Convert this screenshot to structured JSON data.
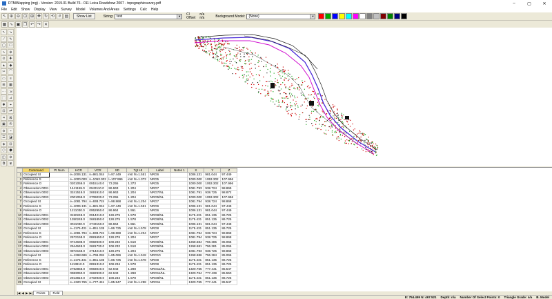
{
  "window": {
    "title": "DTM/Mapping (mg) - Version: 2019.01 Build 76 - 011 Leica Roadshow 2007 - topographicsurvey.pdf",
    "minimize": "–",
    "maximize": "▢",
    "close": "✕"
  },
  "menu": [
    "File",
    "Edit",
    "Show",
    "Display",
    "View",
    "Survey",
    "Model",
    "Volumes And Areas",
    "Settings",
    "Calc",
    "Help"
  ],
  "toolbar": {
    "show_list": "Show List",
    "string_label": "String:",
    "string_value": "test",
    "offset_top": "Cl",
    "offset_bottom": "Offset",
    "ratio_top": "n/a",
    "ratio_bottom": "n/a",
    "background_label": "Background Model:",
    "background_value": "(None)",
    "swatches": [
      "#ff0000",
      "#00aa00",
      "#0000ff",
      "#ffff00",
      "#00ffff",
      "#ff00ff",
      "#ffffff",
      "#808080",
      "#c0c0c0",
      "#800000",
      "#008000",
      "#000080",
      "#000000"
    ]
  },
  "grid": {
    "headers": [
      "Command",
      "Pt Num",
      "HCR",
      "VCR",
      "SD",
      "Tgt Ht",
      "Label",
      "Notes 1",
      "X",
      "Y",
      "Z"
    ],
    "rows": [
      [
        "Occupied St",
        "",
        "e=1006.131",
        "n=981.044",
        "l=97.449",
        "inst ht=1.551",
        "NRG6",
        "",
        "1006.131",
        "981.044",
        "97.449"
      ],
      [
        "Reference S",
        "",
        "e=1000.000",
        "n=1053.302",
        "l=107.996",
        "inst ht=1.373",
        "NRG5",
        "",
        "1000.000",
        "1053.302",
        "107.996"
      ],
      [
        "Reference O",
        "",
        "0201059.0",
        "0915140.0",
        "73.255",
        "1.373",
        "NRG5",
        "",
        "1000.000",
        "1053.302",
        "107.996"
      ],
      [
        "Observation 0001",
        "",
        "1441159.0",
        "0943110.0",
        "86.963",
        "1.204",
        "NRG7",
        "",
        "1081.793",
        "938.724",
        "98.869"
      ],
      [
        "Observation 0002",
        "",
        "3241519.0",
        "2691910.0",
        "86.963",
        "1.204",
        "NRG7/NL",
        "",
        "1081.791",
        "938.725",
        "98.872"
      ],
      [
        "Observation 0003",
        "",
        "2001059.0",
        "2709030.0",
        "73.255",
        "1.204",
        "NRG5/NL",
        "",
        "1000.000",
        "1053.302",
        "107.996"
      ],
      [
        "Occupied St",
        "",
        "e=1081.794",
        "n=938.724",
        "l=98.868",
        "inst ht=1.204",
        "NRG7",
        "",
        "1081.794",
        "938.724",
        "98.868"
      ],
      [
        "Reference S",
        "",
        "e=1006.131",
        "n=981.044",
        "l=97.449",
        "inst ht=1.551",
        "NRG6",
        "",
        "1006.131",
        "981.044",
        "97.449"
      ],
      [
        "Reference O",
        "",
        "1211030.0",
        "0952950.0",
        "86.964",
        "1.551",
        "NRG6",
        "",
        "1006.131",
        "981.044",
        "97.449"
      ],
      [
        "Observation 0001",
        "",
        "3150248.0",
        "0914210.0",
        "128.275",
        "1.578",
        "NRG8/NL",
        "",
        "1175.431",
        "851.135",
        "86.725"
      ],
      [
        "Observation 0002",
        "",
        "1350248.0",
        "2681850.0",
        "128.275",
        "1.578",
        "NRG8/NL",
        "",
        "1175.431",
        "851.135",
        "86.725"
      ],
      [
        "Observation 0003",
        "",
        "3011030.0",
        "2743150.0",
        "86.964",
        "1.551",
        "NRG6/NL",
        "",
        "1006.131",
        "981.044",
        "97.449"
      ],
      [
        "Occupied St",
        "",
        "e=1175.431",
        "n=851.135",
        "l=86.725",
        "inst ht=1.578",
        "NRG8",
        "",
        "1175.431",
        "851.135",
        "86.725"
      ],
      [
        "Reference S",
        "",
        "e=1081.794",
        "n=938.724",
        "l=98.868",
        "inst ht=1.204",
        "NRG7",
        "",
        "1081.794",
        "938.724",
        "98.868"
      ],
      [
        "Reference O",
        "",
        "2672158.0",
        "0881650.0",
        "128.276",
        "1.204",
        "NRG7",
        "",
        "1081.794",
        "938.725",
        "98.868"
      ],
      [
        "Observation 0001",
        "",
        "0744638.0",
        "0982930.0",
        "108.232",
        "1.518",
        "NRG9/NL",
        "",
        "1268.684",
        "796.285",
        "85.066"
      ],
      [
        "Observation 0002",
        "",
        "2544648.0",
        "2681730.0",
        "108.232",
        "1.518",
        "NRG9/NL",
        "",
        "1268.681",
        "796.281",
        "85.066"
      ],
      [
        "Observation 0003",
        "",
        "0872158.0",
        "2714210.0",
        "128.275",
        "1.204",
        "NRG7/NL",
        "",
        "1081.793",
        "938.725",
        "98.868"
      ],
      [
        "Occupied St",
        "",
        "e=1268.686",
        "n=796.284",
        "l=85.066",
        "inst ht=1.518",
        "NRG10",
        "",
        "1268.686",
        "796.284",
        "85.066"
      ],
      [
        "Reference S",
        "",
        "e=1175.431",
        "n=851.135",
        "l=86.725",
        "inst ht=1.578",
        "NRG8",
        "",
        "1175.431",
        "851.135",
        "86.725"
      ],
      [
        "Reference O",
        "",
        "1113810.0",
        "0891310.0",
        "108.234",
        "1.578",
        "NRG8",
        "",
        "1175.431",
        "851.135",
        "86.725"
      ],
      [
        "Observation 0001",
        "",
        "2782858.0",
        "0983040.0",
        "62.943",
        "1.298",
        "NRG11/NL",
        "",
        "1320.765",
        "777.441",
        "85.547"
      ],
      [
        "Observation 0002",
        "",
        "0983050.0",
        "2682930.0",
        "62.943",
        "1.298",
        "NRG11/NL",
        "",
        "1320.764",
        "777.439",
        "85.550"
      ],
      [
        "Observation 0003",
        "",
        "2913810.0",
        "2702930.0",
        "108.234",
        "1.578",
        "NRG8/NL",
        "",
        "1175.431",
        "851.135",
        "86.725"
      ],
      [
        "Occupied St",
        "",
        "e=1320.765",
        "n=777.441",
        "l=85.547",
        "inst ht=1.298",
        "NRG11",
        "",
        "1320.765",
        "777.441",
        "85.547"
      ]
    ]
  },
  "sheet_tabs": [
    "Points",
    "Field"
  ],
  "status": {
    "coords": "E: 754.459  N: 467.521",
    "depth": "Depth: n/a",
    "select": "Number Of Select Points: 0",
    "triangle": "Triangle Grade: n/a",
    "model": "B. Model"
  }
}
